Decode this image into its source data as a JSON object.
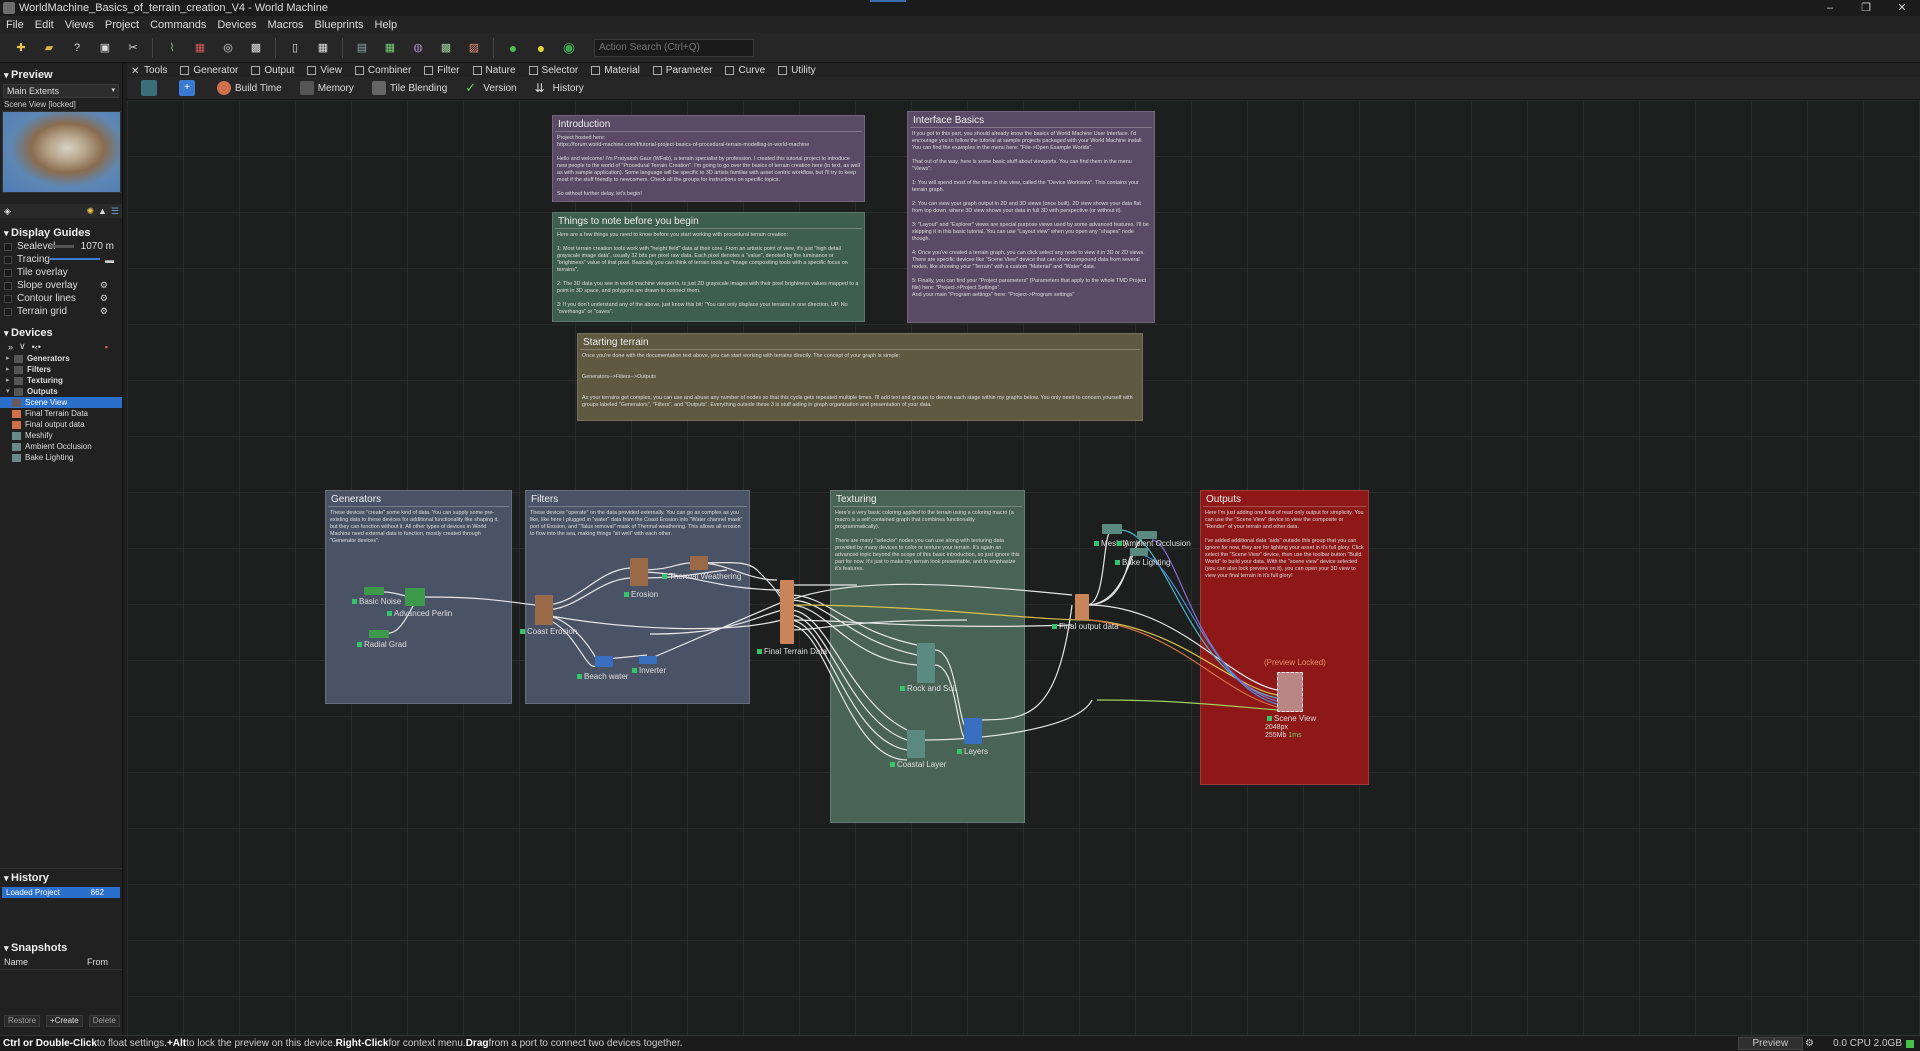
{
  "window": {
    "title": "WorldMachine_Basics_of_terrain_creation_V4 - World Machine",
    "controls": [
      "–",
      "❐",
      "✕"
    ]
  },
  "menu": [
    "File",
    "Edit",
    "Views",
    "Project",
    "Commands",
    "Devices",
    "Macros",
    "Blueprints",
    "Help"
  ],
  "toolbar": {
    "search_placeholder": "Action Search (Ctrl+Q)"
  },
  "preview": {
    "header": "Preview",
    "extents": "Main Extents",
    "scene_label": "Scene View [locked]"
  },
  "display_guides": {
    "header": "Display Guides",
    "sealevel_label": "Sealevel",
    "sealevel_value": "1070 m",
    "tracing_label": "Tracing",
    "items": [
      "Tile overlay",
      "Slope overlay",
      "Contour lines",
      "Terrain grid"
    ]
  },
  "devices": {
    "header": "Devices",
    "categories": [
      "Generators",
      "Filters",
      "Texturing",
      "Outputs"
    ],
    "outputs_children": [
      "Scene View",
      "Final Terrain Data",
      "Final output data",
      "Meshify",
      "Ambient Occlusion",
      "Bake Lighting"
    ]
  },
  "history": {
    "header": "History",
    "item": "Loaded Project",
    "item_value": "862"
  },
  "snapshots": {
    "header": "Snapshots",
    "col_name": "Name",
    "col_from": "From",
    "restore": "Restore",
    "create": "+Create",
    "delete": "Delete"
  },
  "tabs": [
    "Tools",
    "Generator",
    "Output",
    "View",
    "Combiner",
    "Filter",
    "Nature",
    "Selector",
    "Material",
    "Parameter",
    "Curve",
    "Utility"
  ],
  "subtools": [
    "Build Time",
    "Memory",
    "Tile Blending",
    "Version",
    "History"
  ],
  "groups": {
    "intro": {
      "title": "Introduction",
      "body": "Project hosted here:\nhttps://forum.world-machine.com/t/tutorial-project-basics-of-procedural-terrain-modelling-in-world-machine\n\nHello and welcome! I'm Pratyaksh Gaur (WFab), a terrain specialist by profession. I created this tutorial project to introduce new people to the world of \"Procedural Terrain Creation\". I'm going to go over the basics of terrain creation here (in text, as well as with sample application). Some language will be specific to 3D artists familiar with asset centric workflow, but I'll try to keep most if the stuff friendly to newcomers. Check all the groups for instructions on specific topics.\n\nSo without further delay, let's begin!"
    },
    "notes": {
      "title": "Things to note before you begin",
      "body": "Here are a few things you need to know before you start working with procedural terrain creation:\n\n1: Most terrain creation tools work with \"height field\" data at their core. From an artistic point of view, it's just \"high detail grayscale image data\", usually 32 bits per pixel raw data. Each pixel denotes a \"value\", denoted by the luminance or \"brightness\" value of that pixel. Basically you can think of terrain tools as \"image compositing tools with a specific focus on terrains\".\n\n2: The 3D data you see in world machine viewports, is just 2D grayscale images with their pixel brightness values mapped to a point in 3D space, and polygons are drawn to connect them.\n\n3: If you don't understand any of the above, just know this bit: \"You can only displace your terrains in one direction, UP. No \"overhangs\" or \"caves\"."
    },
    "interface": {
      "title": "Interface Basics",
      "body": "If you got to this part, you should already know the basics of World Machine User Interface. I'd encourage you to follow the tutorial at sample projects packaged with your World Machine install. You can find the examples in the menu here: \"File->Open Example Worlds\".\n\nThat out of the way, here is some basic stuff about viewports. You can find them in the menu \"Views\":\n\n1: You will spend most of the time in this view, called the \"Device Workview\". This contains your terrain graph.\n\n2: You can view your graph output in 2D and 3D views (once built). 2D view shows your data flat from top down, where 3D view shows your data in full 3D with perspective (or without it).\n\n3: \"Layout\" and \"Explorer\" views are special purpose views used by some advanced features. I'll be skipping it in this basic tutorial. You can use \"Layout view\" when you open any \"shapes\" node though.\n\n4: Once you've created a terrain graph, you can click select any node to view it in 3D or 2D views. There are specific devices like \"Scene View\" device that can show compound data from several nodes, like showing your \"Terrain\" with a custom \"Material\" and \"Water\" data.\n\n5: Finally, you can find your \"Project parameters\" (Parameters that apply to the whole TMD Project file) here: \"Project->Project Settings\".\nAnd your main \"Program settings\" here: \"Project->Program settings\""
    },
    "starting": {
      "title": "Starting terrain",
      "body": "Once you're done with the documentation text above, you can start working with terrains directly. The concept of your graph is simple:\n\n\nGenerators-->Filters-->Outputs\n\n\nAs your terrains get complex, you can use and abuse any number of nodes so that this cycle gets repeated multiple times. I'll add text and groups to denote each stage within my graphs below. You only need to concern yourself with groups labeled \"Generators\", \"Filters\", and \"Outputs\". Everything outside these 3 is stuff aiding in graph organization and presentation of your data."
    },
    "generators": {
      "title": "Generators",
      "body": "These devices \"create\" some kind of data. You can supply some pre-existing data to these devices for additional functionality like shaping it, but they can function without it. All other types of devices in World Machine need external data to function, mostly created through \"Generator devices\"."
    },
    "filters": {
      "title": "Filters",
      "body": "These devices \"operate\" on the data provided externally. You can go as complex as you like, like here I plugged in \"water\" data from the Coast Erosion into \"Water channel mask\" port of Erosion, and \"Talus removal\" mask of Thermal weathering. This allows all erosion to flow into the sea, making things \"sit well\" with each other."
    },
    "texturing": {
      "title": "Texturing",
      "body": "Here's a very basic coloring applied to the terrain using a coloring macro (a macro is a self contained graph that combines functionality programmatically).\n\nThere are many \"selector\" nodes you can use along with texturing data provided by many devices to color or texture your terrain. It's again an advanced topic beyond the scope of this basic introduction, so just ignore this part for now. It's just to make my terrain look presentable, and to emphasize it's features."
    },
    "outputs": {
      "title": "Outputs",
      "body": "Here I'm just adding one kind of read only output for simplicity. You can use the \"Scene View\" device to view the composite or \"Render\" of your terrain and other data.\n\nI've added additional data \"aids\" outside this group that you can ignore for now, they are for lighting your asset in it's full glory. Click select the \"Scene View\" device, then use the toolbar button \"Build World\" to build your data. With the \"scene view\" device selected (you can also lock preview on it), you can open your 3D view to view your final terrain in it's full glory!"
    }
  },
  "nodes": {
    "basic_noise": "Basic Noise",
    "advanced_perlin": "Advanced Perlin",
    "radial_grad": "Radial Grad",
    "coast_erosion": "Coast Erosion",
    "erosion": "Erosion",
    "thermal": "Thermal Weathering",
    "beach_water": "Beach water",
    "inverter": "Inverter",
    "final_terrain": "Final Terrain Data",
    "rock_soil": "Rock and Soil",
    "coastal_layer": "Coastal Layer",
    "layers": "Layers",
    "final_output": "Final output data",
    "meshify": "Meshify",
    "ambient_occlusion": "Ambient Occlusion",
    "bake_lighting": "Bake Lighting",
    "preview_locked": "(Preview Locked)",
    "scene_view": "Scene View",
    "scene_res": "2048px",
    "scene_mem": "255Mb",
    "scene_time": "1ms"
  },
  "status": {
    "ctrl": "Ctrl or Double-Click",
    "t1": " to float settings. ",
    "alt": "+Alt",
    "t2": " to lock the preview on this device. ",
    "right": "Right-Click",
    "t3": " for context menu. ",
    "drag": "Drag",
    "t4": " from a port to connect two devices together.",
    "preview": "Preview",
    "cpu": "0.0 CPU 2.0GB"
  }
}
